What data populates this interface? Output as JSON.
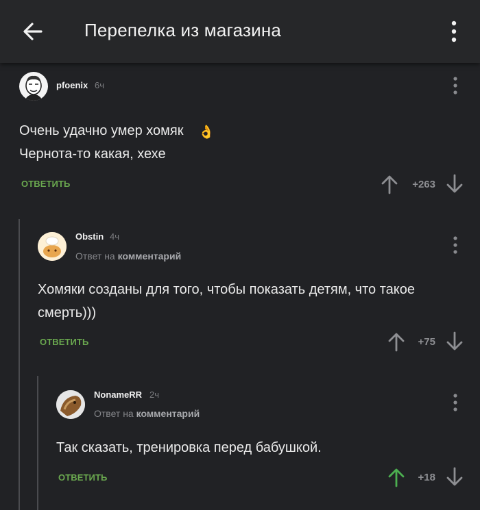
{
  "header": {
    "title": "Перепелка из магазина",
    "back_icon": "arrow-left-icon",
    "menu_icon": "more-vertical-icon"
  },
  "reply_label": "ОТВЕТИТЬ",
  "reply_prefix": "Ответ на",
  "reply_target": "комментарий",
  "colors": {
    "accent_green": "#6aa84f",
    "upvoted": "#4caf50",
    "background": "#212225"
  },
  "comments": [
    {
      "author": "pfoenix",
      "time": "6ч",
      "text": "Очень удачно умер хомяк\nЧернота-то какая, хехе",
      "emoji": "👌",
      "score": "+263",
      "upvoted": false
    },
    {
      "author": "Obstin",
      "time": "4ч",
      "text": "Хомяки созданы для того, чтобы показать детям, что такое\nсмерть)))",
      "score": "+75",
      "upvoted": false
    },
    {
      "author": "NonameRR",
      "time": "2ч",
      "text": "Так сказать, тренировка перед бабушкой.",
      "score": "+18",
      "upvoted": true
    }
  ]
}
